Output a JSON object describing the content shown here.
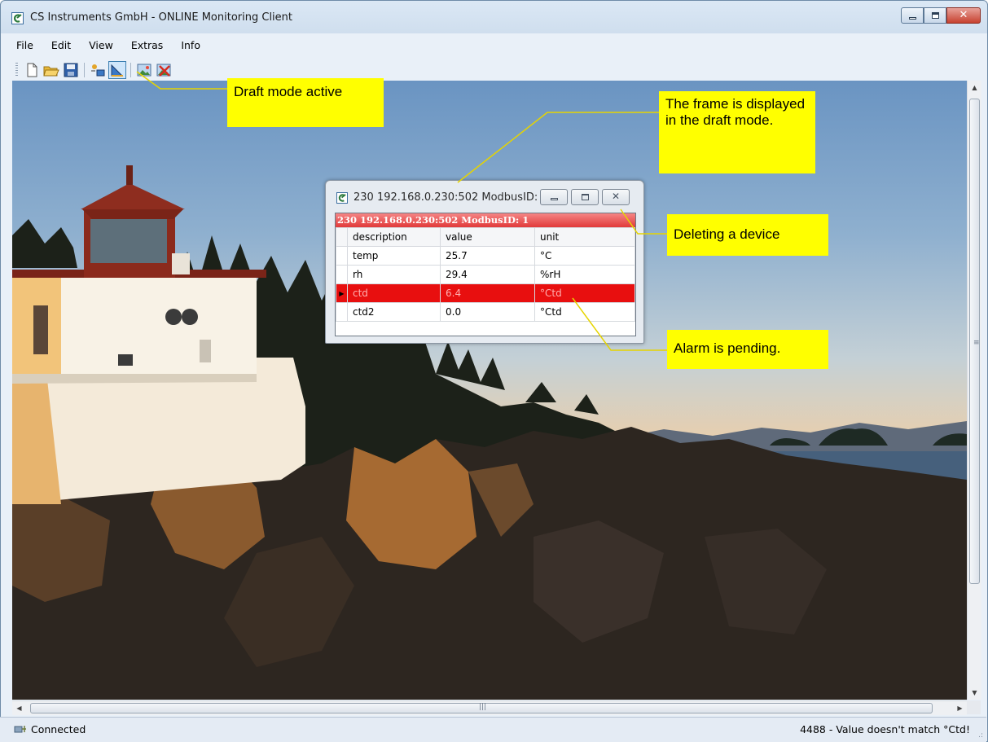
{
  "window": {
    "title": "CS Instruments GmbH - ONLINE Monitoring Client",
    "buttons": [
      "minimize",
      "maximize",
      "close"
    ]
  },
  "menu": [
    "File",
    "Edit",
    "View",
    "Extras",
    "Info"
  ],
  "toolbar": {
    "icons": [
      "new-file-icon",
      "open-folder-icon",
      "save-icon",
      "add-device-icon",
      "draft-mode-icon",
      "background-image-icon",
      "remove-background-icon"
    ],
    "active": "draft-mode-icon"
  },
  "device_window": {
    "title": "230 192.168.0.230:502 ModbusID: 1",
    "caption": "230 192.168.0.230:502 ModbusID: 1",
    "columns": [
      "description",
      "value",
      "unit"
    ],
    "rows": [
      {
        "description": "temp",
        "value": "25.7",
        "unit": "°C",
        "alarm": false
      },
      {
        "description": "rh",
        "value": "29.4",
        "unit": "%rH",
        "alarm": false
      },
      {
        "description": "ctd",
        "value": "6.4",
        "unit": "°Ctd",
        "alarm": true
      },
      {
        "description": "ctd2",
        "value": "0.0",
        "unit": "°Ctd",
        "alarm": false
      }
    ],
    "alarm_color": "#e80f0f"
  },
  "callouts": {
    "draft_mode": "Draft mode active",
    "frame_draft": "The frame is displayed in the draft mode.",
    "delete_device": "Deleting a device",
    "alarm_pending": "Alarm is pending."
  },
  "statusbar": {
    "left": "Connected",
    "right": "4488 - Value doesn't match °Ctd!"
  },
  "colors": {
    "callout_bg": "#ffff00",
    "leader_line": "#e6d400"
  }
}
